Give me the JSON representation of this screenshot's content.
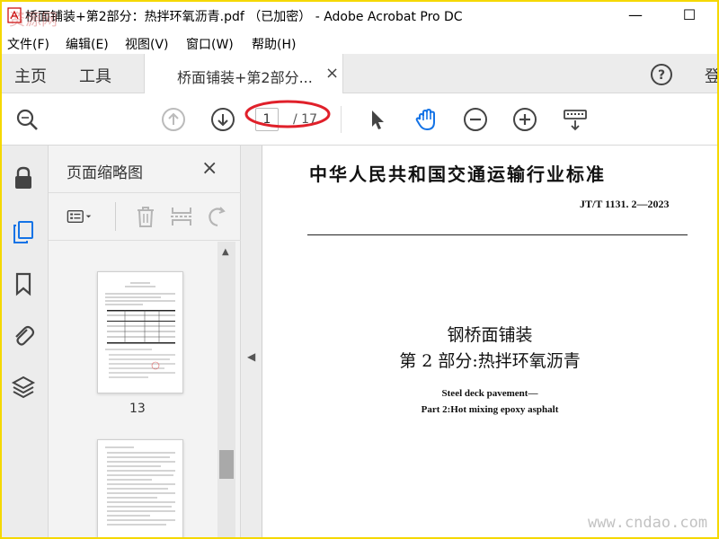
{
  "window": {
    "title": "桥面铺装+第2部分：热拌环氧沥青.pdf （已加密） - Adobe Acrobat Pro DC",
    "watermark_top_left": "资源网",
    "buttons": {
      "minimize": "—",
      "maximize": "☐"
    }
  },
  "menubar": {
    "items": [
      "文件(F)",
      "编辑(E)",
      "视图(V)",
      "窗口(W)",
      "帮助(H)"
    ]
  },
  "tabbar": {
    "home": "主页",
    "tools": "工具",
    "doc_tab": "桥面铺装+第2部分...",
    "close": "×",
    "help": "?",
    "login": "登"
  },
  "toolbar": {
    "current_page": "1",
    "total_pages": "/ 17",
    "icons": [
      "search-icon",
      "page-up-icon",
      "page-down-icon",
      "select-arrow-icon",
      "hand-icon",
      "zoom-out-icon",
      "zoom-in-icon",
      "keyboard-icon"
    ],
    "highlight_color": "#e0202a"
  },
  "left_rail": {
    "icons": [
      "lock-icon",
      "pages-icon",
      "bookmark-icon",
      "paperclip-icon",
      "layers-icon"
    ],
    "accent": "#1473e6"
  },
  "thumbnail_panel": {
    "title": "页面缩略图",
    "close": "×",
    "thumbnails": [
      {
        "label": "13"
      },
      {
        "label": ""
      }
    ]
  },
  "document": {
    "heading": "中华人民共和国交通运输行业标准",
    "standard_no": "JT/T 1131. 2—2023",
    "title_line1": "钢桥面铺装",
    "title_line2": "第 2 部分:热拌环氧沥青",
    "english_line1": "Steel deck pavement—",
    "english_line2": "Part 2:Hot mixing epoxy asphalt",
    "watermark": "www.cndao.com"
  }
}
